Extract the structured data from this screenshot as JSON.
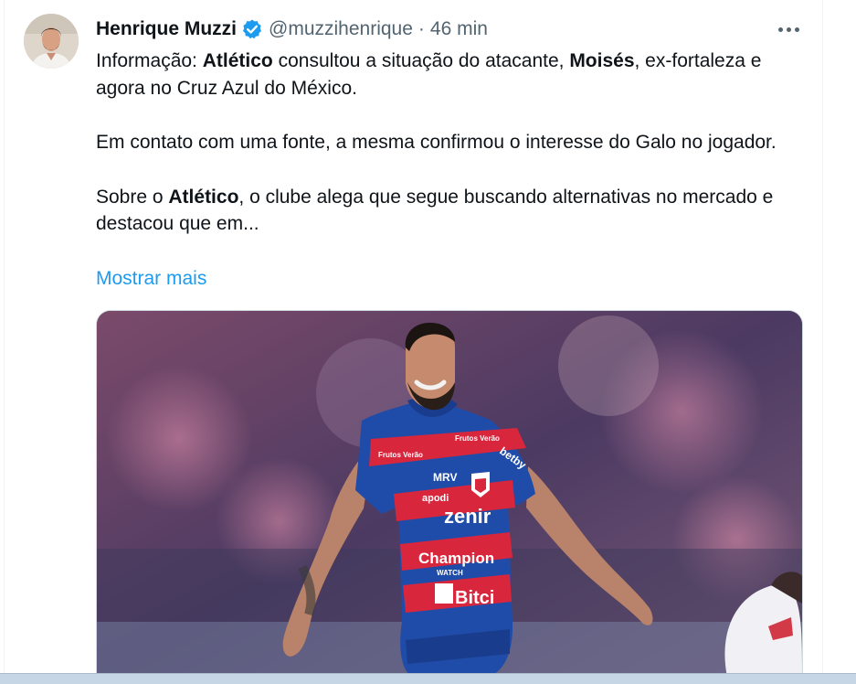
{
  "tweet": {
    "author_name": "Henrique Muzzi",
    "handle": "@muzzihenrique",
    "separator": "·",
    "time": "46 min",
    "paragraph1": {
      "t1": "Informação: ",
      "b1": "Atlético",
      "t2": " consultou a situação do atacante, ",
      "b2": "Moisés",
      "t3": ", ex-fortaleza e agora no Cruz Azul do México."
    },
    "paragraph2": "Em contato com uma fonte, a mesma confirmou o interesse do Galo no jogador.",
    "paragraph3": {
      "t1": "Sobre o ",
      "b1": "Atlético",
      "t2": ", o clube alega que segue buscando alternativas no mercado e destacou que em..."
    },
    "show_more": "Mostrar mais",
    "shirt_text": {
      "mrv": "MRV",
      "apodi": "apodi",
      "zenir": "zenir",
      "champion": "Champion",
      "watch": "WATCH",
      "bitci": "Bitci",
      "betby": "betby",
      "frutos_left": "Frutos Verão",
      "frutos_right": "Frutos Verão"
    }
  },
  "colors": {
    "link": "#1d9bf0",
    "verified": "#1d9bf0",
    "text": "#0f1419",
    "secondary": "#536471"
  },
  "icons": {
    "verified": "verified-badge-icon",
    "more": "more-dots-icon"
  }
}
